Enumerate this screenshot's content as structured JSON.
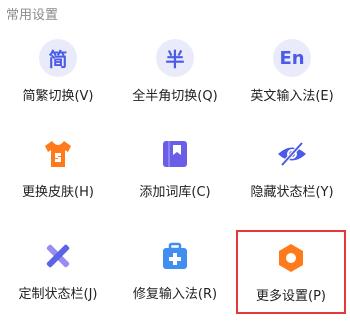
{
  "section": {
    "title": "常用设置"
  },
  "items": [
    {
      "label": "简繁切换(V)",
      "icon_text": "简",
      "icon": "jian-text-icon"
    },
    {
      "label": "全半角切换(Q)",
      "icon_text": "半",
      "icon": "ban-text-icon"
    },
    {
      "label": "英文输入法(E)",
      "icon_text": "En",
      "icon": "en-text-icon"
    },
    {
      "label": "更换皮肤(H)",
      "icon": "tshirt-icon"
    },
    {
      "label": "添加词库(C)",
      "icon": "book-icon"
    },
    {
      "label": "隐藏状态栏(Y)",
      "icon": "eye-hidden-icon"
    },
    {
      "label": "定制状态栏(J)",
      "icon": "tools-icon"
    },
    {
      "label": "修复输入法(R)",
      "icon": "toolbox-plus-icon"
    },
    {
      "label": "更多设置(P)",
      "icon": "settings-hexagon-icon",
      "selected": true
    }
  ],
  "colors": {
    "icon_blue": "#4b5be8",
    "icon_orange": "#ff7a1a",
    "selection_border": "#e53935"
  }
}
